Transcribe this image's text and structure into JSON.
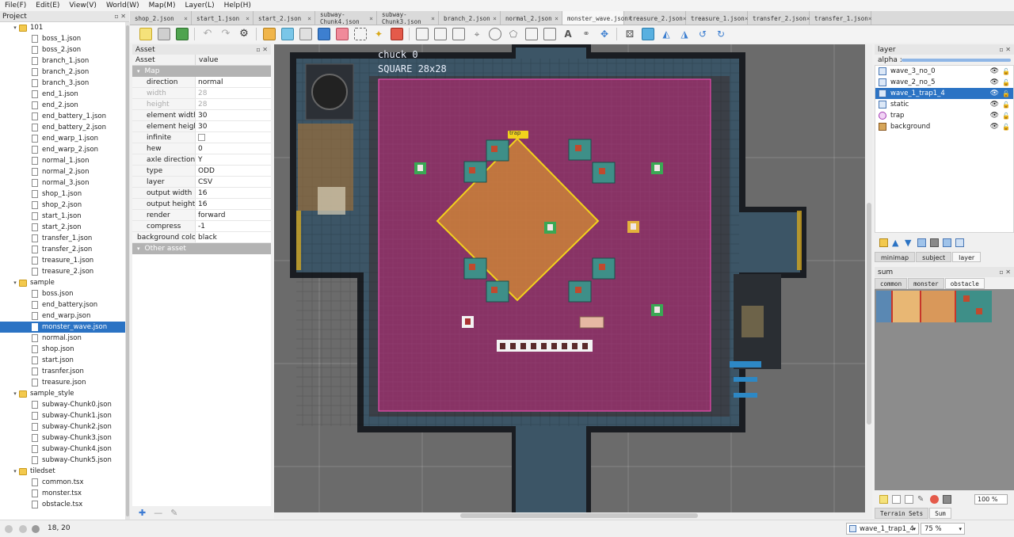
{
  "menu": [
    "File(F)",
    "Edit(E)",
    "View(V)",
    "World(W)",
    "Map(M)",
    "Layer(L)",
    "Help(H)"
  ],
  "project": {
    "title": "Project",
    "tree": [
      {
        "label": "101",
        "kind": "folder",
        "depth": 0,
        "expanded": true
      },
      {
        "label": "boss_1.json",
        "kind": "file",
        "depth": 1
      },
      {
        "label": "boss_2.json",
        "kind": "file",
        "depth": 1
      },
      {
        "label": "branch_1.json",
        "kind": "file",
        "depth": 1
      },
      {
        "label": "branch_2.json",
        "kind": "file",
        "depth": 1
      },
      {
        "label": "branch_3.json",
        "kind": "file",
        "depth": 1
      },
      {
        "label": "end_1.json",
        "kind": "file",
        "depth": 1
      },
      {
        "label": "end_2.json",
        "kind": "file",
        "depth": 1
      },
      {
        "label": "end_battery_1.json",
        "kind": "file",
        "depth": 1
      },
      {
        "label": "end_battery_2.json",
        "kind": "file",
        "depth": 1
      },
      {
        "label": "end_warp_1.json",
        "kind": "file",
        "depth": 1
      },
      {
        "label": "end_warp_2.json",
        "kind": "file",
        "depth": 1
      },
      {
        "label": "normal_1.json",
        "kind": "file",
        "depth": 1
      },
      {
        "label": "normal_2.json",
        "kind": "file",
        "depth": 1
      },
      {
        "label": "normal_3.json",
        "kind": "file",
        "depth": 1
      },
      {
        "label": "shop_1.json",
        "kind": "file",
        "depth": 1
      },
      {
        "label": "shop_2.json",
        "kind": "file",
        "depth": 1
      },
      {
        "label": "start_1.json",
        "kind": "file",
        "depth": 1
      },
      {
        "label": "start_2.json",
        "kind": "file",
        "depth": 1
      },
      {
        "label": "transfer_1.json",
        "kind": "file",
        "depth": 1
      },
      {
        "label": "transfer_2.json",
        "kind": "file",
        "depth": 1
      },
      {
        "label": "treasure_1.json",
        "kind": "file",
        "depth": 1
      },
      {
        "label": "treasure_2.json",
        "kind": "file",
        "depth": 1
      },
      {
        "label": "sample",
        "kind": "folder",
        "depth": 0,
        "expanded": true
      },
      {
        "label": "boss.json",
        "kind": "file",
        "depth": 1
      },
      {
        "label": "end_battery.json",
        "kind": "file",
        "depth": 1
      },
      {
        "label": "end_warp.json",
        "kind": "file",
        "depth": 1
      },
      {
        "label": "monster_wave.json",
        "kind": "file",
        "depth": 1,
        "selected": true
      },
      {
        "label": "normal.json",
        "kind": "file",
        "depth": 1
      },
      {
        "label": "shop.json",
        "kind": "file",
        "depth": 1
      },
      {
        "label": "start.json",
        "kind": "file",
        "depth": 1
      },
      {
        "label": "trasnfer.json",
        "kind": "file",
        "depth": 1
      },
      {
        "label": "treasure.json",
        "kind": "file",
        "depth": 1
      },
      {
        "label": "sample_style",
        "kind": "folder",
        "depth": 0,
        "expanded": true
      },
      {
        "label": "subway-Chunk0.json",
        "kind": "file",
        "depth": 1
      },
      {
        "label": "subway-Chunk1.json",
        "kind": "file",
        "depth": 1
      },
      {
        "label": "subway-Chunk2.json",
        "kind": "file",
        "depth": 1
      },
      {
        "label": "subway-Chunk3.json",
        "kind": "file",
        "depth": 1
      },
      {
        "label": "subway-Chunk4.json",
        "kind": "file",
        "depth": 1
      },
      {
        "label": "subway-Chunk5.json",
        "kind": "file",
        "depth": 1
      },
      {
        "label": "tiledset",
        "kind": "folder",
        "depth": 0,
        "expanded": true
      },
      {
        "label": "common.tsx",
        "kind": "file",
        "depth": 1
      },
      {
        "label": "monster.tsx",
        "kind": "file",
        "depth": 1
      },
      {
        "label": "obstacle.tsx",
        "kind": "file",
        "depth": 1
      }
    ]
  },
  "tabs": [
    {
      "label": "shop_2.json"
    },
    {
      "label": "start_1.json"
    },
    {
      "label": "start_2.json"
    },
    {
      "label": "subway-Chunk4.json"
    },
    {
      "label": "subway-Chunk3.json"
    },
    {
      "label": "branch_2.json"
    },
    {
      "label": "normal_2.json"
    },
    {
      "label": "monster_wave.json",
      "active": true
    },
    {
      "label": "treasure_2.json"
    },
    {
      "label": "treasure_1.json"
    },
    {
      "label": "transfer_2.json"
    },
    {
      "label": "transfer_1.json"
    }
  ],
  "asset": {
    "title": "Asset",
    "col_key": "Asset",
    "col_value": "value",
    "group_map": "Map",
    "group_other": "Other asset",
    "props": [
      {
        "key": "direction",
        "value": "normal"
      },
      {
        "key": "width",
        "value": "28",
        "disabled": true
      },
      {
        "key": "height",
        "value": "28",
        "disabled": true
      },
      {
        "key": "element width",
        "value": "30"
      },
      {
        "key": "element height",
        "value": "30"
      },
      {
        "key": "infinite",
        "value": "",
        "checkbox": true
      },
      {
        "key": "hew",
        "value": "0"
      },
      {
        "key": "axle direction",
        "value": "Y"
      },
      {
        "key": "type",
        "value": "ODD"
      },
      {
        "key": "layer",
        "value": "CSV"
      },
      {
        "key": "output width",
        "value": "16"
      },
      {
        "key": "output height",
        "value": "16"
      },
      {
        "key": "render",
        "value": "forward"
      },
      {
        "key": "compress",
        "value": "-1"
      },
      {
        "key": "background color",
        "value": "black",
        "expandable": true
      }
    ]
  },
  "map": {
    "chuck_label": "chuck 0",
    "square_label": "SQUARE 28x28",
    "trap_tag": "trap"
  },
  "layer": {
    "title": "layer",
    "alpha_label": "alpha :",
    "items": [
      {
        "name": "wave_3_no_0",
        "icon": "tile-layer-icon"
      },
      {
        "name": "wave_2_no_5",
        "icon": "tile-layer-icon"
      },
      {
        "name": "wave_1_trap1_4",
        "icon": "tile-layer-icon",
        "selected": true
      },
      {
        "name": "static",
        "icon": "tile-layer-icon"
      },
      {
        "name": "trap",
        "icon": "object-layer-icon"
      },
      {
        "name": "background",
        "icon": "image-layer-icon"
      }
    ],
    "tabs": [
      "minimap",
      "subject",
      "layer"
    ],
    "active_tab": "layer"
  },
  "sum": {
    "title": "sum",
    "tabs": [
      "common",
      "monster",
      "obstacle"
    ],
    "active_tab": "obstacle",
    "zoom": "100 %",
    "bottom_tabs": [
      "Terrain Sets",
      "Sum"
    ],
    "active_bottom_tab": "Sum"
  },
  "status": {
    "coords": "18, 20",
    "layer_select": "wave_1_trap1_4",
    "zoom": "75 %"
  },
  "colors": {
    "selection": "#2b73c4",
    "highlight_region": "#c8297d",
    "trap_outline": "#f2d21c"
  }
}
